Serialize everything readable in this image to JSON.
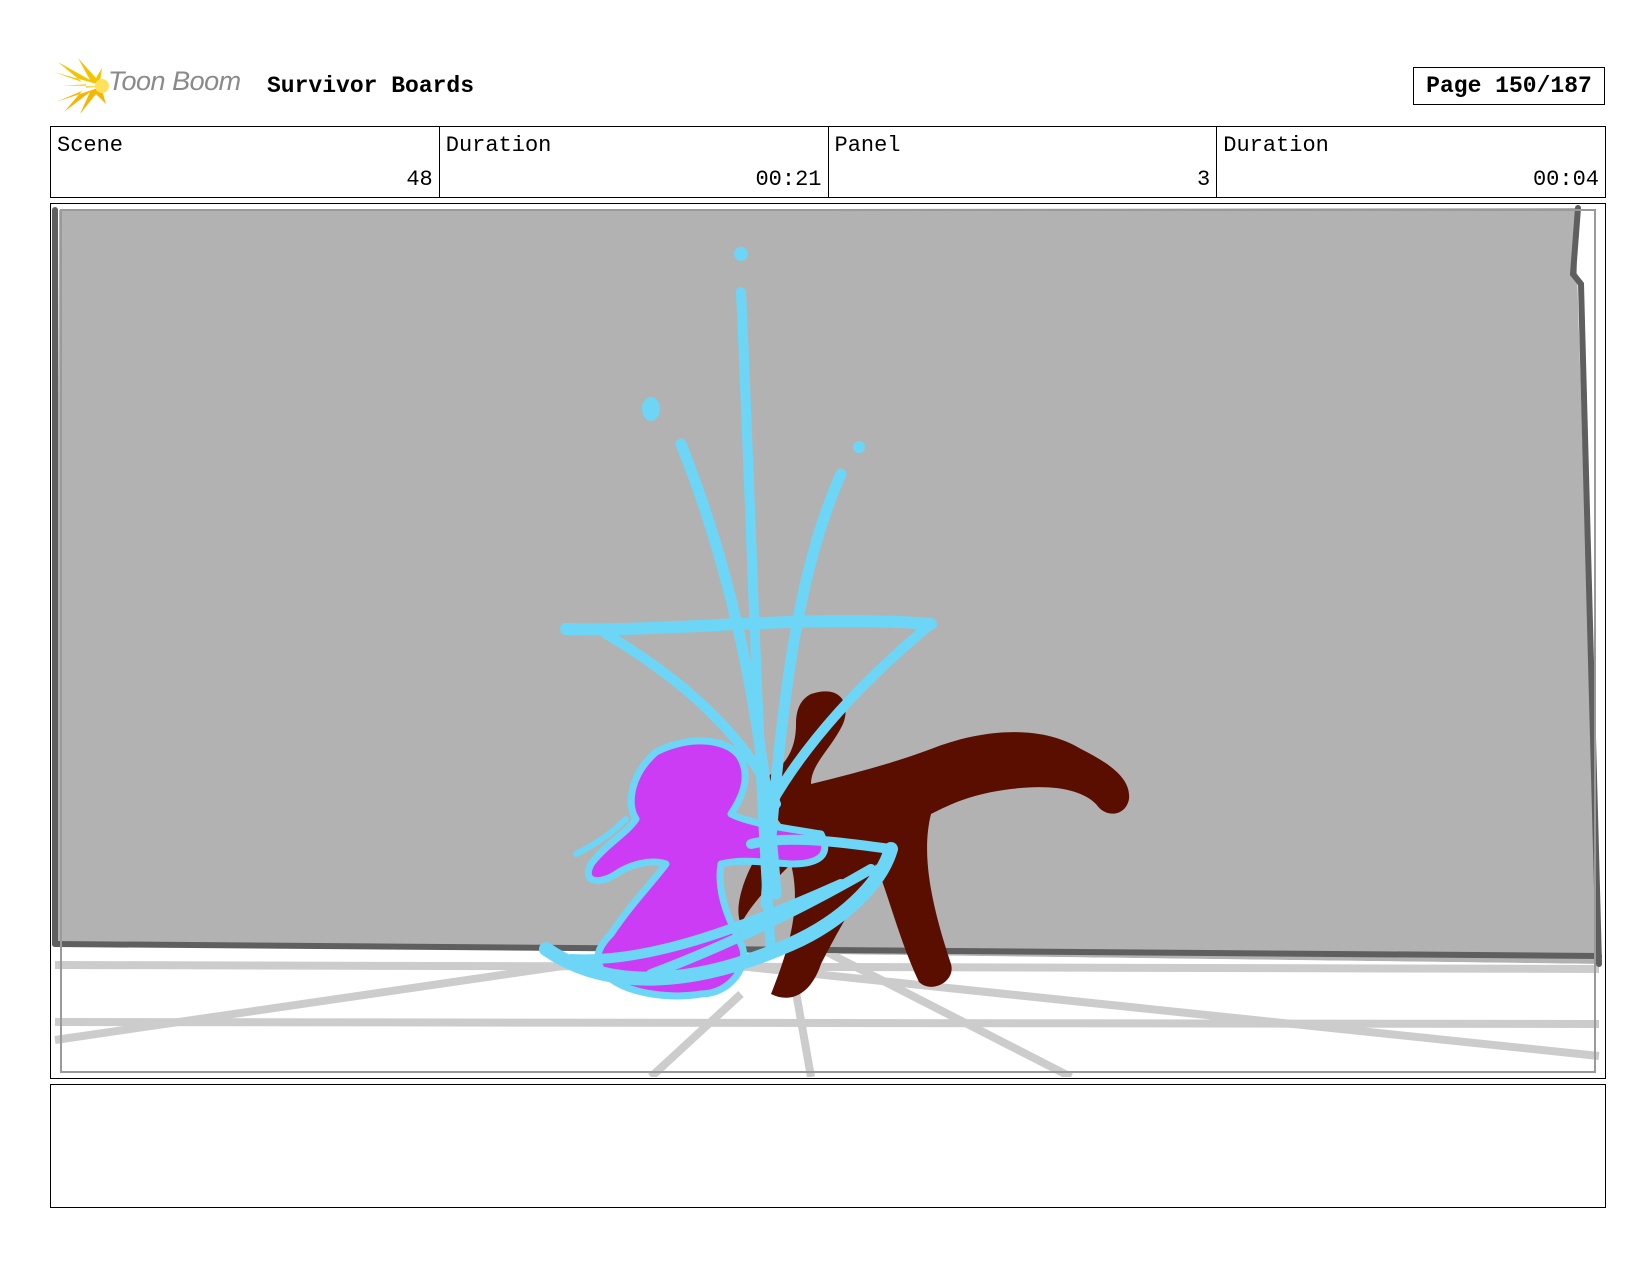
{
  "header": {
    "logo_text": "Toon Boom",
    "project_title": "Survivor Boards",
    "page_label": "Page 150/187"
  },
  "info": [
    {
      "label": "Scene",
      "value": "48"
    },
    {
      "label": "Duration",
      "value": "00:21"
    },
    {
      "label": "Panel",
      "value": "3"
    },
    {
      "label": "Duration",
      "value": "00:04"
    }
  ],
  "panel": {
    "colors": {
      "wall": "#b2b2b2",
      "floor": "#ffffff",
      "floor_lines": "#cccccc",
      "wall_edge": "#5f5f5f",
      "splash": "#6dd6f7",
      "girl": "#cc3cf5",
      "creature": "#5a0e00"
    }
  },
  "notes": {
    "text": ""
  }
}
